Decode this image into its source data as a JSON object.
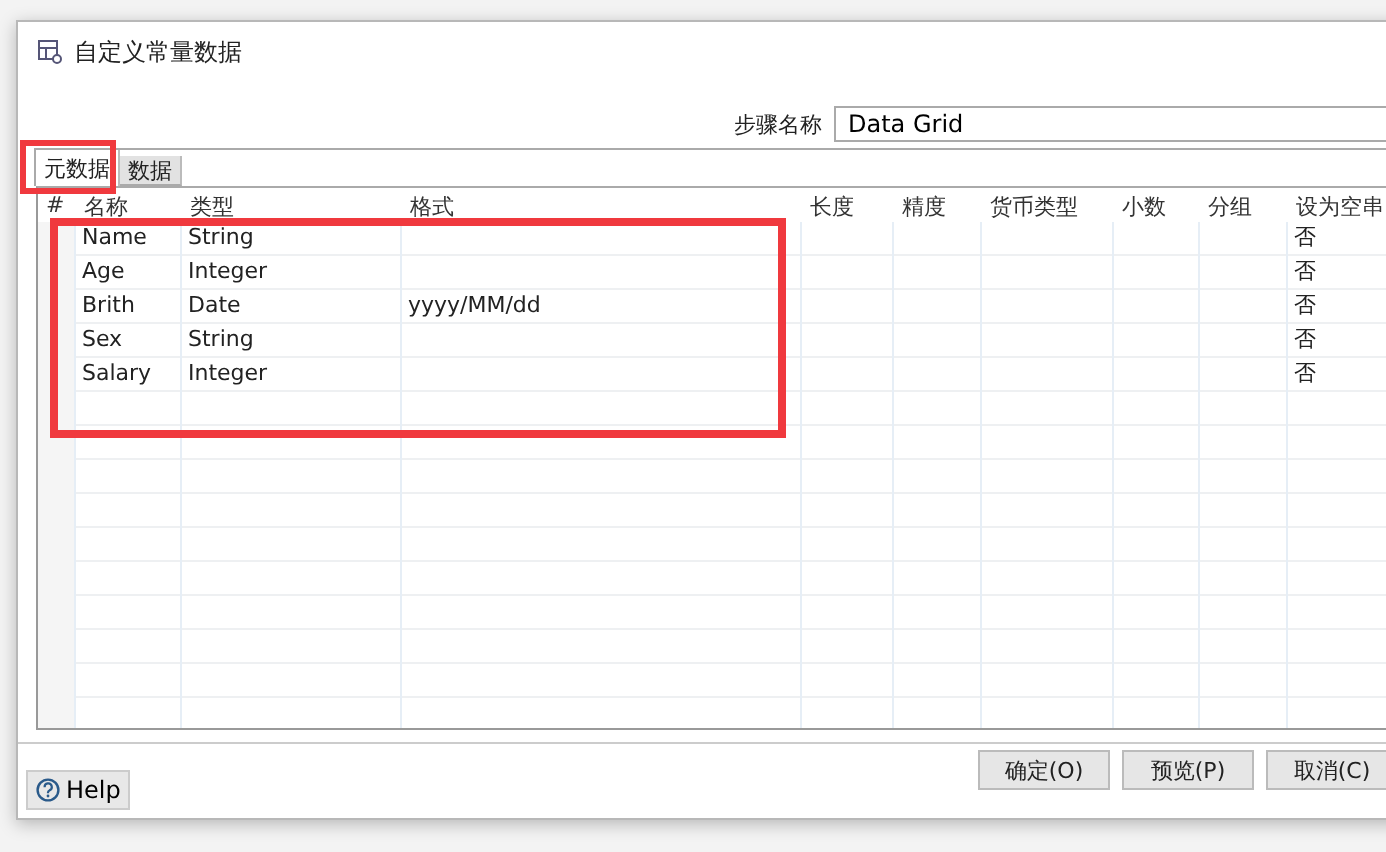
{
  "window": {
    "title": "自定义常量数据"
  },
  "step_name": {
    "label": "步骤名称",
    "value": "Data Grid"
  },
  "tabs": [
    {
      "label": "元数据",
      "selected": true,
      "highlighted": true
    },
    {
      "label": "数据",
      "selected": false,
      "highlighted": false
    }
  ],
  "table": {
    "rows_highlighted": true,
    "columns": [
      "#",
      "名称",
      "类型",
      "格式",
      "长度",
      "精度",
      "货币类型",
      "小数",
      "分组",
      "设为空串"
    ],
    "rows": [
      {
        "name": "Name",
        "type": "String",
        "format": "",
        "empty_string": "否"
      },
      {
        "name": "Age",
        "type": "Integer",
        "format": "",
        "empty_string": "否"
      },
      {
        "name": "Brith",
        "type": "Date",
        "format": "yyyy/MM/dd",
        "empty_string": "否"
      },
      {
        "name": "Sex",
        "type": "String",
        "format": "",
        "empty_string": "否"
      },
      {
        "name": "Salary",
        "type": "Integer",
        "format": "",
        "empty_string": "否"
      }
    ]
  },
  "help_button": "Help",
  "buttons": [
    "确定(O)",
    "预览(P)",
    "取消(C)"
  ]
}
